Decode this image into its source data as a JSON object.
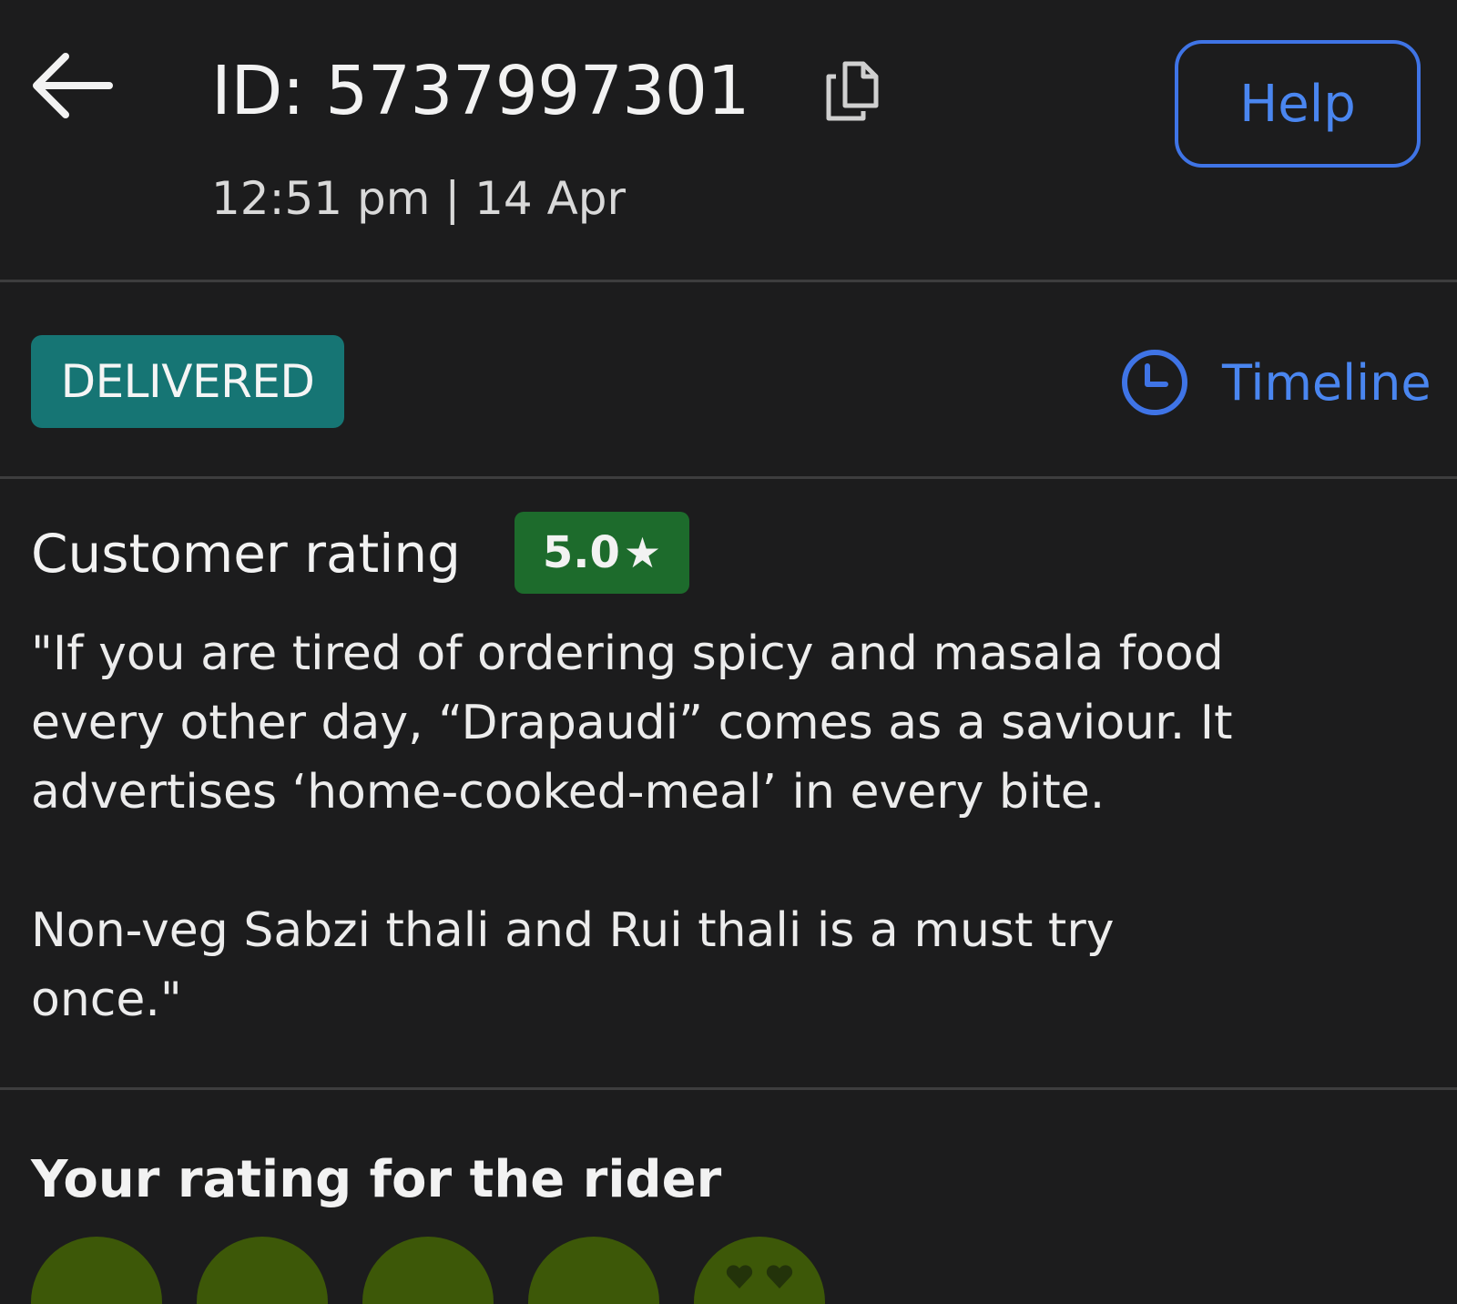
{
  "header": {
    "order_id": "ID: 5737997301",
    "timestamp": "12:51 pm | 14 Apr",
    "help_label": "Help",
    "icons": {
      "back": "arrow-left-icon",
      "copy": "copy-icon"
    }
  },
  "status": {
    "badge": "DELIVERED",
    "timeline_label": "Timeline",
    "timeline_icon": "clock-icon",
    "colors": {
      "badge_bg": "#167574",
      "link": "#4a86f0"
    }
  },
  "customer_rating": {
    "heading": "Customer rating",
    "score": "5.0",
    "star": "★",
    "review_lines": [
      "\"If you are tired of ordering spicy and masala food\nevery other day, “Drapaudi” comes as a saviour. It\nadvertises ‘home-cooked-meal’ in every bite.",
      "Non-veg Sabzi thali and Rui thali is a must try\nonce.\""
    ],
    "colors": {
      "score_bg": "#1d6b2c"
    }
  },
  "rider_rating": {
    "heading": "Your rating for the rider",
    "faces": [
      "rating-face-1",
      "rating-face-2",
      "rating-face-3",
      "rating-face-4",
      "rating-face-5-heart-eyes"
    ],
    "colors": {
      "face": "#3d5808"
    }
  }
}
